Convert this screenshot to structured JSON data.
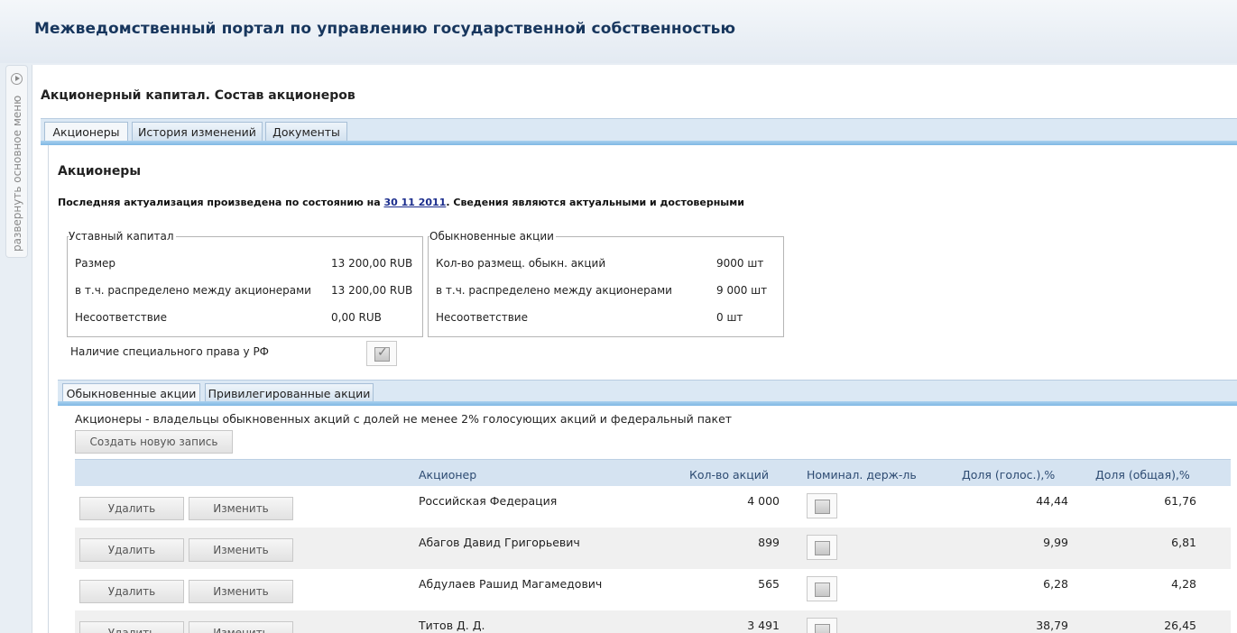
{
  "header": {
    "title": "Межведомственный портал по управлению государственной собственностью"
  },
  "sidebar": {
    "expand_label": "развернуть основное меню"
  },
  "page": {
    "title": "Акционерный капитал. Состав акционеров"
  },
  "tabs": [
    {
      "label": "Акционеры",
      "active": true
    },
    {
      "label": "История изменений",
      "active": false
    },
    {
      "label": "Документы",
      "active": false
    }
  ],
  "section": {
    "title": "Акционеры",
    "actual_prefix": "Последняя актуализация произведена по состоянию на",
    "actual_date": "30 11 2011",
    "actual_suffix": ". Сведения являются актуальными и достоверными"
  },
  "charter": {
    "legend": "Уставный капитал",
    "rows": [
      {
        "label": "Размер",
        "value": "13 200,00 RUB"
      },
      {
        "label": "в т.ч. распределено между акционерами",
        "value": "13 200,00 RUB"
      },
      {
        "label": "Несоответствие",
        "value": "0,00 RUB"
      }
    ]
  },
  "ordinary": {
    "legend": "Обыкновенные акции",
    "rows": [
      {
        "label": "Кол-во размещ. обыкн. акций",
        "value": "9000 шт"
      },
      {
        "label": "в т.ч. распределено между акционерами",
        "value": "9 000 шт"
      },
      {
        "label": "Несоответствие",
        "value": "0 шт"
      }
    ]
  },
  "special_right": {
    "label": "Наличие специального права у РФ",
    "checked": true
  },
  "subtabs": [
    {
      "label": "Обыкновенные акции",
      "active": true
    },
    {
      "label": "Привилегированные акции",
      "active": false
    }
  ],
  "grid_note": "Акционеры - владельцы обыкновенных акций с долей не менее 2% голосующих акций и федеральный пакет",
  "create_button": "Создать новую запись",
  "columns": {
    "holder": "Акционер",
    "shares": "Кол-во акций",
    "nominee": "Номинал. держ-ль",
    "vote_share": "Доля (голос.),%",
    "total_share": "Доля (общая),%"
  },
  "row_buttons": {
    "delete": "Удалить",
    "edit": "Изменить"
  },
  "rows": [
    {
      "holder": "Российская Федерация",
      "shares": "4 000",
      "nominee": false,
      "vote_share": "44,44",
      "total_share": "61,76"
    },
    {
      "holder": "Абагов Давид Григорьевич",
      "shares": "899",
      "nominee": false,
      "vote_share": "9,99",
      "total_share": "6,81"
    },
    {
      "holder": "Абдулаев Рашид Магамедович",
      "shares": "565",
      "nominee": false,
      "vote_share": "6,28",
      "total_share": "4,28"
    },
    {
      "holder": "Титов Д. Д.",
      "shares": "3 491",
      "nominee": false,
      "vote_share": "38,79",
      "total_share": "26,45"
    }
  ]
}
